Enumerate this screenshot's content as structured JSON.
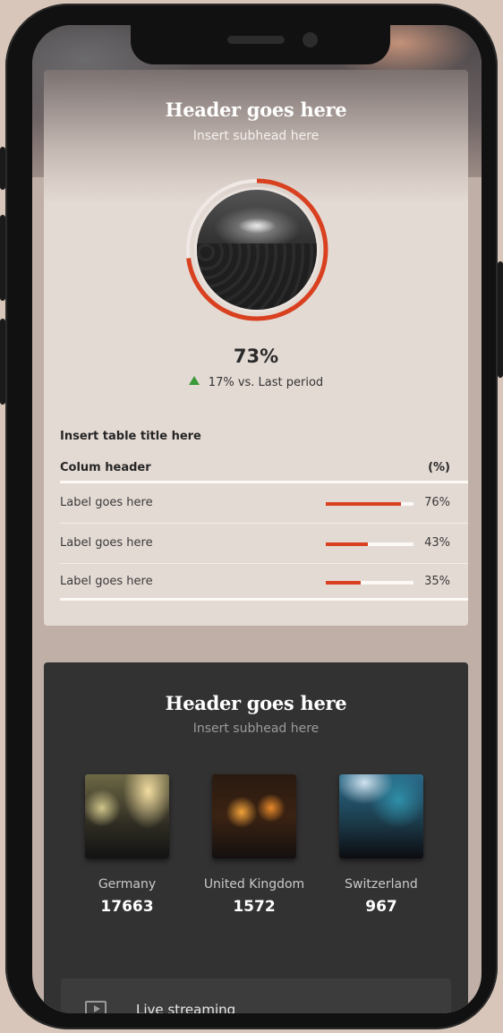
{
  "card_top": {
    "title": "Header goes here",
    "subtitle": "Insert subhead here",
    "progress": {
      "percent": 73,
      "label": "73%"
    },
    "delta_text": "17% vs. Last period",
    "delta_direction": "up",
    "table": {
      "title": "Insert table title here",
      "column_header": "Colum header",
      "column_unit": "(%)",
      "rows": [
        {
          "label": "Label goes here",
          "value": 76,
          "value_label": "76%"
        },
        {
          "label": "Label goes here",
          "value": 43,
          "value_label": "43%"
        },
        {
          "label": "Label goes here",
          "value": 35,
          "value_label": "35%"
        }
      ]
    }
  },
  "card_bottom": {
    "title": "Header goes here",
    "subtitle": "Insert subhead here",
    "countries": [
      {
        "name": "Germany",
        "value": "17663"
      },
      {
        "name": "United Kingdom",
        "value": "1572"
      },
      {
        "name": "Switzerland",
        "value": "967"
      }
    ],
    "live_label": "Live streaming"
  },
  "colors": {
    "accent": "#d8401f",
    "up": "#3b9a3a",
    "dark_card": "#333232",
    "light_card": "#e4dad4"
  }
}
